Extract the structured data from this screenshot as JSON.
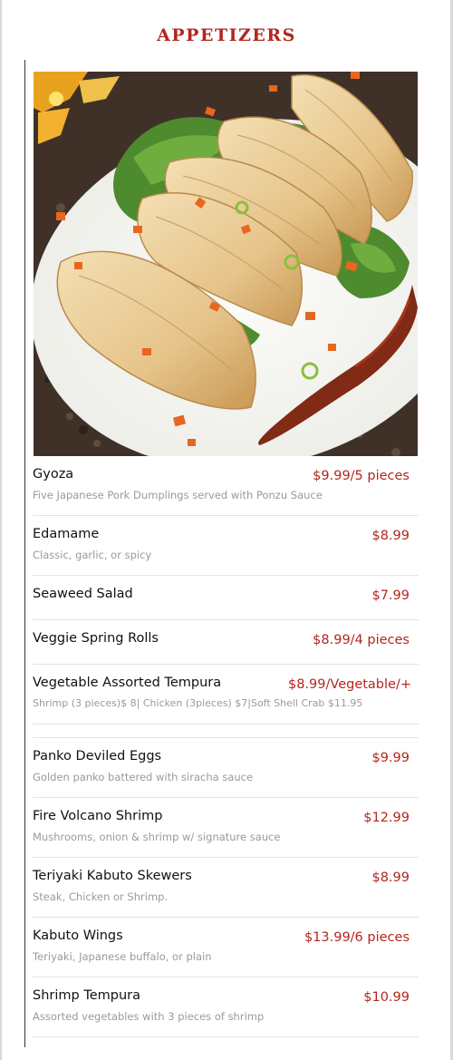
{
  "section": {
    "title": "APPETIZERS"
  },
  "photo": {
    "alt": "Gyoza"
  },
  "items": [
    {
      "name": "Gyoza",
      "price": "$9.99/5 pieces",
      "desc": "Five Japanese Pork Dumplings served with Ponzu Sauce"
    },
    {
      "name": "Edamame",
      "price": "$8.99",
      "desc": "Classic, garlic, or spicy"
    },
    {
      "name": "Seaweed Salad",
      "price": "$7.99",
      "desc": ""
    },
    {
      "name": "Veggie Spring Rolls",
      "price": "$8.99/4 pieces",
      "desc": ""
    },
    {
      "name": "Vegetable Assorted Tempura",
      "price": "$8.99/Vegetable/+",
      "desc": "Shrimp (3 pieces)$ 8| Chicken (3pieces) $7|Soft Shell Crab $11.95"
    },
    {
      "name": "Panko Deviled Eggs",
      "price": "$9.99",
      "desc": "Golden panko battered with siracha sauce"
    },
    {
      "name": "Fire Volcano Shrimp",
      "price": "$12.99",
      "desc": "Mushrooms, onion & shrimp w/ signature sauce"
    },
    {
      "name": "Teriyaki Kabuto Skewers",
      "price": "$8.99",
      "desc": "Steak, Chicken or Shrimp."
    },
    {
      "name": "Kabuto Wings",
      "price": "$13.99/6 pieces",
      "desc": "Teriyaki, Japanese buffalo, or plain"
    },
    {
      "name": "Shrimp Tempura",
      "price": "$10.99",
      "desc": "Assorted vegetables with 3 pieces of shrimp"
    }
  ]
}
